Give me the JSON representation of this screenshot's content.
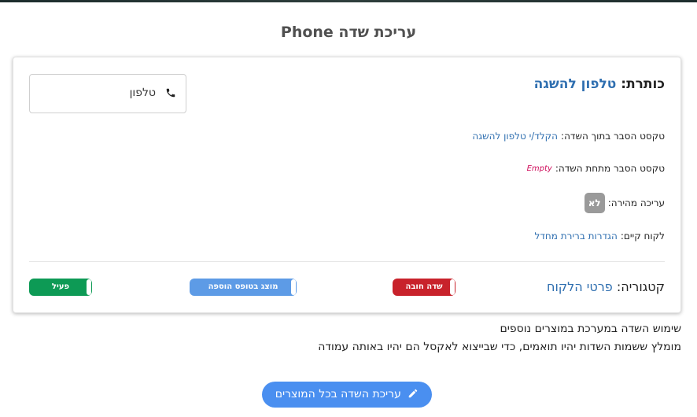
{
  "page": {
    "title": "עריכת שדה Phone"
  },
  "card": {
    "heading_label": "כותרת:",
    "heading_value": "טלפון להשגה",
    "preview": {
      "icon": "phone-icon",
      "text": "טלפון"
    },
    "rows": {
      "inner_hint_label": "טקסט הסבר בתוך השדה:",
      "inner_hint_value": "הקלד/י טלפון להשגה",
      "below_hint_label": "טקסט הסבר מתחת השדה:",
      "below_hint_value": "Empty",
      "quick_edit_label": "עריכה מהירה:",
      "quick_edit_value": "לא",
      "existing_customer_label": "לקוח קיים:",
      "existing_customer_value": "הגדרות ברירת מחדל"
    },
    "category_label": "קטגוריה:",
    "category_value": "פרטי הלקוח",
    "toggles": {
      "required": "שדה חובה",
      "shown_in_addon_form": "מוצג בטופס הוספה",
      "active": "פעיל"
    }
  },
  "info": {
    "line1": "שימוש השדה במערכת במוצרים נוספים",
    "line2": "מומלץ ששמות השדות יהיו תואמים, כדי שבייצוא לאקסל הם יהיו באותה עמודה"
  },
  "actions": {
    "edit_all_label": "עריכת השדה בכל המוצרים",
    "edit_icon": "pencil-icon"
  },
  "colors": {
    "link": "#2f6fb0",
    "required": "#c8222b",
    "addon": "#5d9be6",
    "active": "#0d9a55",
    "primary_button": "#4a8ff0"
  }
}
